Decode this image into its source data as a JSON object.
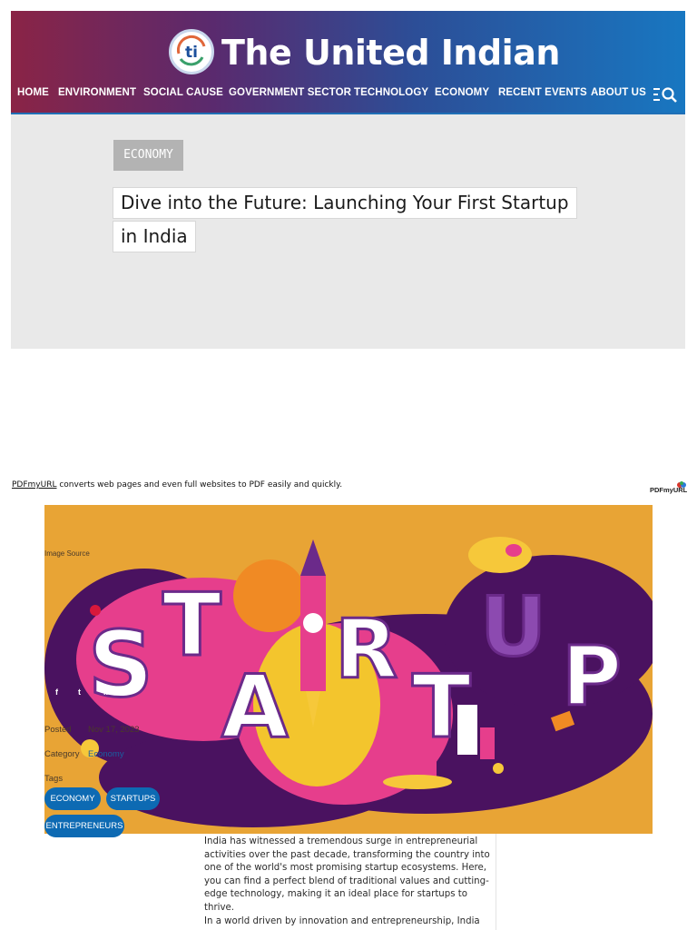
{
  "site": {
    "title": "The United Indian",
    "logo_text": "ti"
  },
  "nav": {
    "items": [
      {
        "label": "HOME"
      },
      {
        "label": "ENVIRONMENT"
      },
      {
        "label": "SOCIAL CAUSE"
      },
      {
        "label": "GOVERNMENT SECTOR"
      },
      {
        "label": "TECHNOLOGY"
      },
      {
        "label": "ECONOMY"
      },
      {
        "label": "RECENT EVENTS"
      },
      {
        "label": "ABOUT US"
      }
    ],
    "search_icon": "menu-search-icon"
  },
  "hero": {
    "category": "ECONOMY",
    "title_line_1": "Dive into the Future: Launching Your First Startup",
    "title_line_2": "in India"
  },
  "pdf_notice": {
    "link_text": "PDFmyURL",
    "text": " converts web pages and even full websites to PDF easily and quickly.",
    "logo_text": "PDFmyURL"
  },
  "featured_image": {
    "source_label": "Image Source",
    "word": "STARTUP"
  },
  "meta": {
    "social": [
      {
        "icon": "facebook-icon",
        "glyph": "f"
      },
      {
        "icon": "twitter-icon",
        "glyph": "t"
      },
      {
        "icon": "linkedin-icon",
        "glyph": "in"
      }
    ],
    "posted_label": "Posted",
    "posted_value": "Nov 17, 2023",
    "category_label": "Category",
    "category_value": "Economy",
    "tags_label": "Tags",
    "tags": [
      "ECONOMY",
      "STARTUPS",
      "ENTREPRENEURS"
    ]
  },
  "article": {
    "paragraph_1": "India has witnessed a tremendous surge in entrepreneurial activities over the past decade, transforming the country into one of the world's most promising startup ecosystems. Here, you can find a perfect blend of traditional values and cutting-edge technology, making it an ideal place for startups to thrive.",
    "paragraph_2": "In a world driven by innovation and entrepreneurship, India"
  },
  "colors": {
    "header_start": "#8a2446",
    "header_end": "#1877c1",
    "hero_bg": "#e9e9e9",
    "image_bg": "#e8a435",
    "tag_blue": "#0d6ab3"
  }
}
